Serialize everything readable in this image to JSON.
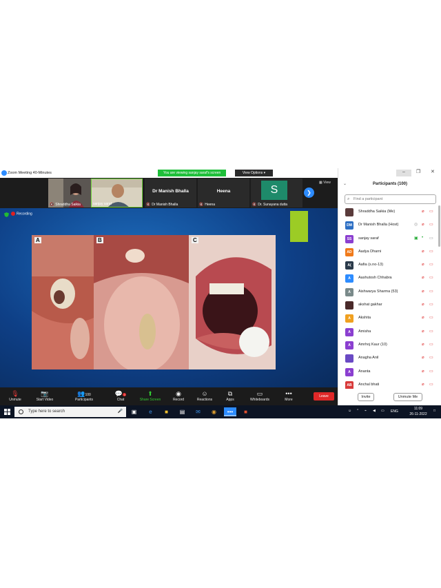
{
  "window": {
    "title": "Zoom Meeting 40-Minutes"
  },
  "banner": {
    "viewing": "You are viewing sanjay saraf's screen",
    "view_options": "View Options ▾"
  },
  "strip": {
    "tiles": [
      {
        "name": "Shraddha Saikia",
        "big": ""
      },
      {
        "name": "sanjay saraf",
        "big": ""
      },
      {
        "name": "Dr Manish Bhalla",
        "big": "Dr Manish Bhalla"
      },
      {
        "name": "Heena",
        "big": "Heena"
      },
      {
        "name": "Dr. Sunayana dutta",
        "big": "S"
      }
    ],
    "view_label": "View"
  },
  "share": {
    "recording": "Recording",
    "slide_labels": [
      "A",
      "B",
      "C"
    ]
  },
  "toolbar": {
    "buttons": [
      {
        "label": "Unmute",
        "icon": "🎙"
      },
      {
        "label": "Start Video",
        "icon": "📷"
      },
      {
        "label": "Participants",
        "icon": "👥",
        "count": "100"
      },
      {
        "label": "Chat",
        "icon": "💬",
        "badge": "3"
      },
      {
        "label": "Share Screen",
        "icon": "⬆"
      },
      {
        "label": "Record",
        "icon": "◉"
      },
      {
        "label": "Reactions",
        "icon": "☺"
      },
      {
        "label": "Apps",
        "icon": "⧉"
      },
      {
        "label": "Whiteboards",
        "icon": "▭"
      },
      {
        "label": "More",
        "icon": "•••"
      }
    ],
    "leave": "Leave"
  },
  "panel": {
    "title": "Participants (100)",
    "search_placeholder": "Find a participant",
    "participants": [
      {
        "name": "Shraddha Saikia (Me)",
        "initials": "",
        "color": "#5a3b3b"
      },
      {
        "name": "Dr Manish Bhalla (Host)",
        "initials": "DM",
        "color": "#2d6fc4"
      },
      {
        "name": "sanjay saraf",
        "initials": "SS",
        "color": "#8b3fd0"
      },
      {
        "name": "Aadya Dharni",
        "initials": "AD",
        "color": "#f07a1a"
      },
      {
        "name": "Aafia (s.no-13)",
        "initials": "A(",
        "color": "#2a3a4a"
      },
      {
        "name": "Aashutosh Chhabra",
        "initials": "A",
        "color": "#2d8cff"
      },
      {
        "name": "Aishwarya Sharma (53)",
        "initials": "A",
        "color": "#7a8a8a"
      },
      {
        "name": "akshat gakhar",
        "initials": "",
        "color": "#4a2a2a"
      },
      {
        "name": "Akshita",
        "initials": "A",
        "color": "#f0a020"
      },
      {
        "name": "Amisha",
        "initials": "A",
        "color": "#8b3fd0"
      },
      {
        "name": "Amrhoj Kaur (10)",
        "initials": "A",
        "color": "#8b3fd0"
      },
      {
        "name": "Anagha Anil",
        "initials": "",
        "color": "#6a4ac4"
      },
      {
        "name": "Ananta",
        "initials": "A",
        "color": "#8b3fd0"
      },
      {
        "name": "Anchal bhati",
        "initials": "AB",
        "color": "#d83a3a"
      }
    ],
    "invite": "Invite",
    "unmute_me": "Unmute Me"
  },
  "taskbar": {
    "search_placeholder": "Type here to search",
    "lang": "ENG",
    "time": "11:09",
    "date": "26-11-2022"
  }
}
